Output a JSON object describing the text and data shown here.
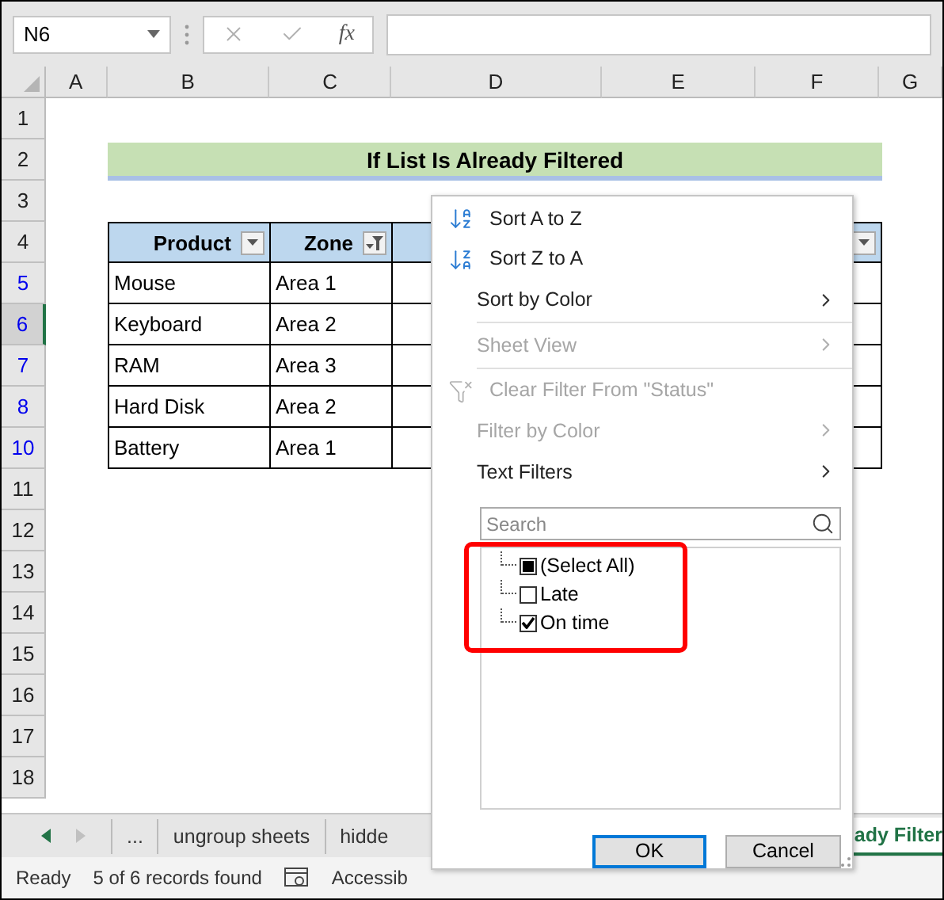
{
  "formula_bar": {
    "name_box": "N6",
    "function_label": "fx"
  },
  "columns": [
    "A",
    "B",
    "C",
    "D",
    "E",
    "F",
    "G"
  ],
  "rows": [
    {
      "number": "1",
      "filtered": false,
      "selected": false
    },
    {
      "number": "2",
      "filtered": false,
      "selected": false
    },
    {
      "number": "3",
      "filtered": false,
      "selected": false
    },
    {
      "number": "4",
      "filtered": false,
      "selected": false
    },
    {
      "number": "5",
      "filtered": true,
      "selected": false
    },
    {
      "number": "6",
      "filtered": true,
      "selected": true
    },
    {
      "number": "7",
      "filtered": true,
      "selected": false
    },
    {
      "number": "8",
      "filtered": true,
      "selected": false
    },
    {
      "number": "10",
      "filtered": true,
      "selected": false
    },
    {
      "number": "11",
      "filtered": false,
      "selected": false
    },
    {
      "number": "12",
      "filtered": false,
      "selected": false
    },
    {
      "number": "13",
      "filtered": false,
      "selected": false
    },
    {
      "number": "14",
      "filtered": false,
      "selected": false
    },
    {
      "number": "15",
      "filtered": false,
      "selected": false
    },
    {
      "number": "16",
      "filtered": false,
      "selected": false
    },
    {
      "number": "17",
      "filtered": false,
      "selected": false
    },
    {
      "number": "18",
      "filtered": false,
      "selected": false
    }
  ],
  "title": "If List Is Already Filtered",
  "table": {
    "headers": [
      {
        "label": "Product",
        "filtered": false
      },
      {
        "label": "Zone",
        "filtered": true
      },
      {
        "filtered": false
      }
    ],
    "rows": [
      [
        "Mouse",
        "Area 1"
      ],
      [
        "Keyboard",
        "Area 2"
      ],
      [
        "RAM",
        "Area 3"
      ],
      [
        "Hard Disk",
        "Area 2"
      ],
      [
        "Battery",
        "Area 1"
      ]
    ]
  },
  "filter_menu": {
    "items": [
      {
        "label": "Sort A to Z",
        "kind": "sort-asc",
        "disabled": false,
        "submenu": false,
        "divider_after": false
      },
      {
        "label": "Sort Z to A",
        "kind": "sort-desc",
        "disabled": false,
        "submenu": false,
        "divider_after": false
      },
      {
        "label": "Sort by Color",
        "kind": "plain",
        "disabled": false,
        "submenu": true,
        "divider_after": true
      },
      {
        "label": "Sheet View",
        "kind": "plain",
        "disabled": true,
        "submenu": true,
        "divider_after": true
      },
      {
        "label": "Clear Filter From \"Status\"",
        "kind": "clear-filter",
        "disabled": true,
        "submenu": false,
        "divider_after": false
      },
      {
        "label": "Filter by Color",
        "kind": "plain",
        "disabled": true,
        "submenu": true,
        "divider_after": false
      },
      {
        "label": "Text Filters",
        "kind": "plain",
        "disabled": false,
        "submenu": true,
        "divider_after": false
      }
    ],
    "search": {
      "placeholder": "Search"
    },
    "values": [
      {
        "label": "(Select All)",
        "checked": true,
        "indeterminate": true
      },
      {
        "label": "Late",
        "checked": false,
        "indeterminate": false
      },
      {
        "label": "On time",
        "checked": true,
        "indeterminate": false
      }
    ],
    "buttons": [
      {
        "label": "OK",
        "default": true
      },
      {
        "label": "Cancel",
        "default": false
      }
    ]
  },
  "sheet_tabs": [
    {
      "label": "...",
      "selected": false
    },
    {
      "label": "ungroup sheets",
      "selected": false
    },
    {
      "label": "hidde",
      "selected": false
    },
    {
      "label": "ady Filter",
      "selected": true
    }
  ],
  "status_bar": {
    "ready": "Ready",
    "records": "5 of 6 records found",
    "accessibility": "Accessib"
  }
}
